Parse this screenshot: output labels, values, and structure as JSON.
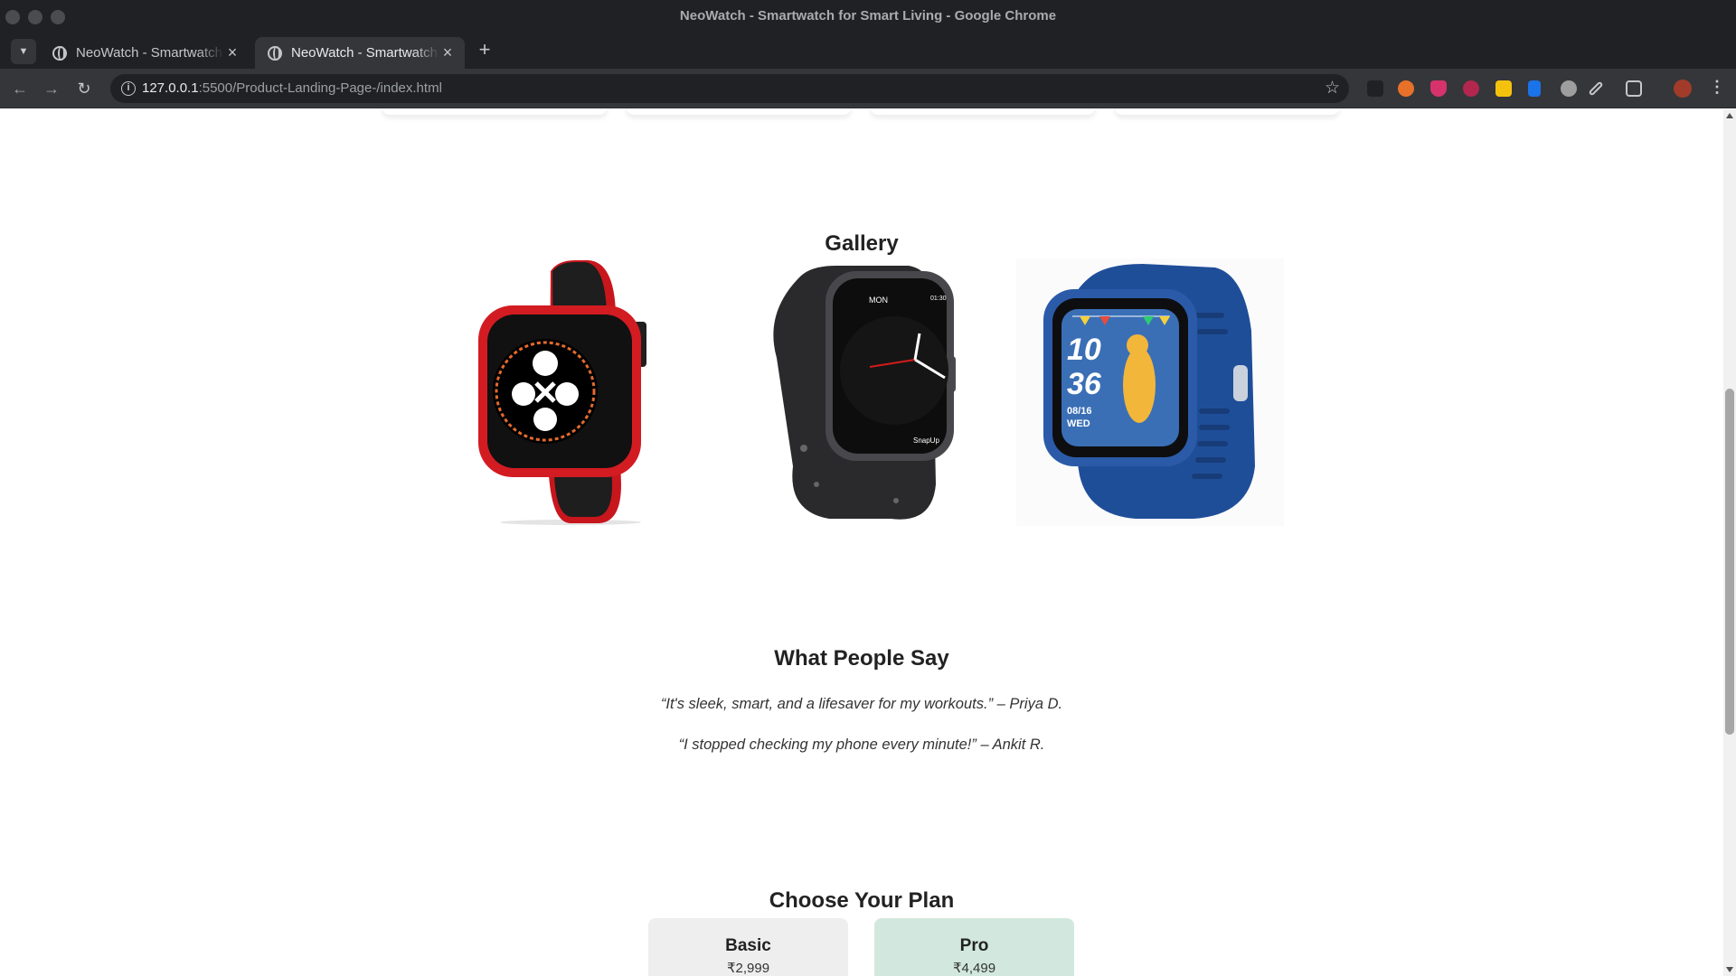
{
  "browser": {
    "window_title": "NeoWatch - Smartwatch for Smart Living - Google Chrome",
    "tabs": [
      {
        "label": "NeoWatch - Smartwatch for Smart Living",
        "active": false
      },
      {
        "label": "NeoWatch - Smartwatch for Smart Living",
        "active": true
      }
    ],
    "url_host": "127.0.0.1",
    "url_path": ":5500/Product-Landing-Page-/index.html",
    "extension_icons": [
      "ink-icon",
      "fox-icon",
      "shield-icon",
      "record-icon",
      "note-icon",
      "board-icon",
      "eyes-icon",
      "eyedropper-icon",
      "puzzle-icon",
      "profile-avatar"
    ]
  },
  "gallery": {
    "title": "Gallery",
    "images": [
      {
        "name": "red-black-smartwatch",
        "band": "#c8161d",
        "case": "#d21c22"
      },
      {
        "name": "black-smartwatch",
        "band": "#2a2a2c",
        "case": "#3a3a3d"
      },
      {
        "name": "blue-kids-smartwatch",
        "band": "#1f4e99",
        "case": "#2b5ba8"
      }
    ]
  },
  "testimonials": {
    "title": "What People Say",
    "quotes": [
      "“It's sleek, smart, and a lifesaver for my workouts.” – Priya D.",
      "“I stopped checking my phone every minute!” – Ankit R."
    ]
  },
  "pricing": {
    "title": "Choose Your Plan",
    "plans": [
      {
        "name": "Basic",
        "price": "₹2,999",
        "color": "#eeeeee"
      },
      {
        "name": "Pro",
        "price": "₹4,499",
        "color": "#d2e8de"
      }
    ]
  }
}
